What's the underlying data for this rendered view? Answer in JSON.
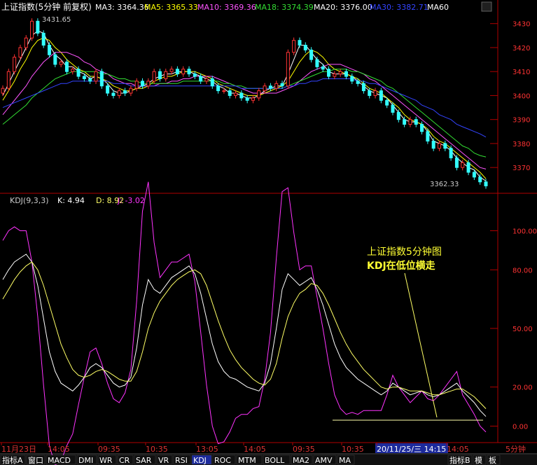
{
  "main_header": {
    "title": "上证指数(5分钟 前复权)",
    "ma": [
      {
        "label": "MA3: 3364.36",
        "color": "#ffffff"
      },
      {
        "label": "MA5: 3365.33",
        "color": "#ffff00"
      },
      {
        "label": "MA10: 3369.36",
        "color": "#ff55ff"
      },
      {
        "label": "MA18: 3374.39",
        "color": "#33dd33"
      },
      {
        "label": "MA20: 3376.00",
        "color": "#ffffff"
      },
      {
        "label": "MA30: 3382.71",
        "color": "#3344ff"
      },
      {
        "label": "MA60",
        "color": "#ffffff"
      }
    ]
  },
  "kdj_header": {
    "label": "KDJ(9,3,3)",
    "k": "K: 4.94",
    "d": "D: 8.92",
    "j": "J: -3.02"
  },
  "annotations": {
    "high": "3431.65",
    "low": "3362.33",
    "note_line1": "上证指数5分钟图",
    "note_line2": "KDJ在低位横走"
  },
  "x_axis": {
    "ticks": [
      "11月23日",
      "14:05",
      "09:35",
      "10:35",
      "13:05",
      "14:05",
      "09:35",
      "10:35",
      "20/11/25/三 14:15",
      "14:05",
      "5分钟"
    ]
  },
  "bottom_tabs": {
    "left": [
      "指标A",
      "窗口",
      "MACD",
      "DMI",
      "WR",
      "CR",
      "SAR",
      "VR",
      "RSI",
      "KDJ",
      "ROC",
      "MTM",
      "BOLL",
      "MA2",
      "AMV",
      "MA"
    ],
    "right": [
      "指标B",
      "模",
      "板"
    ],
    "active": "KDJ"
  },
  "colors": {
    "axis": "#b00000",
    "grid": "#5a0000",
    "up": "#ff3333",
    "down": "#33ffff",
    "k_line": "#ffffff",
    "d_line": "#ffff66",
    "j_line": "#ff33ff",
    "note": "#ffff33"
  },
  "chart_data": [
    {
      "type": "candlestick",
      "title": "上证指数(5分钟 前复权)",
      "ylim": [
        3361,
        3434
      ],
      "yticks": [
        3430,
        3420,
        3410,
        3400,
        3390,
        3380,
        3370
      ],
      "close": [
        3403,
        3410,
        3416,
        3420,
        3424,
        3431,
        3426,
        3421,
        3417,
        3413,
        3414,
        3410,
        3411,
        3408,
        3407,
        3406,
        3410,
        3404,
        3401,
        3400,
        3402,
        3401,
        3403,
        3406,
        3404,
        3406,
        3410,
        3407,
        3410,
        3411,
        3409,
        3411,
        3409,
        3408,
        3406,
        3407,
        3404,
        3402,
        3402,
        3400,
        3401,
        3399,
        3398,
        3399,
        3402,
        3404,
        3403,
        3405,
        3404,
        3418,
        3423,
        3421,
        3419,
        3415,
        3412,
        3411,
        3408,
        3409,
        3410,
        3408,
        3406,
        3405,
        3402,
        3400,
        3402,
        3398,
        3396,
        3393,
        3390,
        3388,
        3390,
        3388,
        3385,
        3381,
        3378,
        3380,
        3378,
        3374,
        3370,
        3372,
        3368,
        3366,
        3364,
        3362.33
      ],
      "ma_series": [
        {
          "name": "MA3",
          "color": "#ffffff",
          "values": [
            3400,
            3405,
            3410,
            3415,
            3420,
            3425,
            3427,
            3426,
            3421,
            3417,
            3415,
            3412,
            3412,
            3410,
            3409,
            3407,
            3408,
            3407,
            3405,
            3402,
            3401,
            3401,
            3402,
            3403,
            3404,
            3405,
            3407,
            3408,
            3409,
            3409,
            3410,
            3410,
            3410,
            3409,
            3408,
            3407,
            3406,
            3404,
            3403,
            3401,
            3401,
            3400,
            3399,
            3399,
            3400,
            3402,
            3403,
            3404,
            3404,
            3409,
            3415,
            3421,
            3421,
            3418,
            3415,
            3413,
            3410,
            3409,
            3409,
            3409,
            3408,
            3406,
            3404,
            3402,
            3401,
            3400,
            3399,
            3396,
            3393,
            3390,
            3389,
            3389,
            3388,
            3385,
            3381,
            3380,
            3379,
            3377,
            3374,
            3372,
            3370,
            3369,
            3366,
            3364.36
          ]
        },
        {
          "name": "MA5",
          "color": "#ffff00",
          "values": [
            3398,
            3402,
            3406,
            3411,
            3415,
            3420,
            3423,
            3424,
            3423,
            3420,
            3418,
            3415,
            3413,
            3411,
            3410,
            3408,
            3408,
            3407,
            3406,
            3404,
            3403,
            3402,
            3402,
            3403,
            3403,
            3404,
            3406,
            3407,
            3408,
            3408,
            3409,
            3410,
            3410,
            3410,
            3409,
            3408,
            3407,
            3405,
            3404,
            3403,
            3402,
            3401,
            3400,
            3400,
            3400,
            3401,
            3402,
            3403,
            3404,
            3406,
            3410,
            3414,
            3417,
            3419,
            3418,
            3416,
            3413,
            3411,
            3410,
            3409,
            3408,
            3407,
            3405,
            3403,
            3402,
            3401,
            3399,
            3397,
            3395,
            3392,
            3390,
            3389,
            3388,
            3386,
            3383,
            3381,
            3380,
            3378,
            3376,
            3374,
            3372,
            3370,
            3368,
            3365.33
          ]
        },
        {
          "name": "MA10",
          "color": "#ff55ff",
          "values": [
            3392,
            3395,
            3398,
            3401,
            3404,
            3408,
            3411,
            3414,
            3416,
            3418,
            3418,
            3418,
            3417,
            3416,
            3414,
            3413,
            3411,
            3410,
            3409,
            3407,
            3406,
            3405,
            3405,
            3404,
            3404,
            3404,
            3404,
            3405,
            3405,
            3406,
            3406,
            3407,
            3407,
            3408,
            3408,
            3408,
            3408,
            3407,
            3406,
            3405,
            3404,
            3403,
            3402,
            3401,
            3401,
            3401,
            3401,
            3401,
            3402,
            3403,
            3404,
            3406,
            3408,
            3410,
            3411,
            3412,
            3413,
            3413,
            3413,
            3412,
            3411,
            3410,
            3409,
            3407,
            3406,
            3404,
            3402,
            3400,
            3398,
            3396,
            3394,
            3392,
            3390,
            3388,
            3386,
            3384,
            3382,
            3380,
            3378,
            3376,
            3374,
            3372,
            3370,
            3369.36
          ]
        },
        {
          "name": "MA18",
          "color": "#33dd33",
          "values": [
            3388,
            3390,
            3392,
            3394,
            3396,
            3399,
            3401,
            3403,
            3405,
            3407,
            3408,
            3409,
            3410,
            3410,
            3410,
            3410,
            3410,
            3409,
            3409,
            3408,
            3407,
            3407,
            3406,
            3406,
            3405,
            3405,
            3405,
            3405,
            3405,
            3405,
            3405,
            3406,
            3406,
            3406,
            3406,
            3406,
            3406,
            3406,
            3405,
            3405,
            3404,
            3404,
            3403,
            3403,
            3403,
            3403,
            3403,
            3403,
            3403,
            3404,
            3405,
            3406,
            3407,
            3408,
            3409,
            3410,
            3410,
            3411,
            3411,
            3411,
            3410,
            3410,
            3409,
            3408,
            3407,
            3406,
            3404,
            3403,
            3401,
            3399,
            3397,
            3395,
            3393,
            3391,
            3389,
            3387,
            3385,
            3383,
            3381,
            3379,
            3378,
            3376,
            3375,
            3374.39
          ]
        },
        {
          "name": "MA30",
          "color": "#3344ff",
          "values": [
            3395,
            3396,
            3397,
            3398,
            3399,
            3400,
            3401,
            3402,
            3403,
            3404,
            3405,
            3405,
            3406,
            3406,
            3406,
            3406,
            3406,
            3406,
            3406,
            3405,
            3405,
            3405,
            3404,
            3404,
            3404,
            3404,
            3404,
            3404,
            3404,
            3404,
            3404,
            3404,
            3404,
            3404,
            3404,
            3404,
            3404,
            3404,
            3404,
            3404,
            3404,
            3403,
            3403,
            3403,
            3403,
            3403,
            3403,
            3403,
            3403,
            3404,
            3404,
            3405,
            3405,
            3406,
            3406,
            3407,
            3407,
            3407,
            3407,
            3407,
            3407,
            3406,
            3406,
            3405,
            3405,
            3404,
            3403,
            3402,
            3401,
            3400,
            3399,
            3398,
            3396,
            3395,
            3394,
            3392,
            3391,
            3390,
            3388,
            3387,
            3386,
            3385,
            3384,
            3382.71
          ]
        }
      ]
    },
    {
      "type": "line",
      "title": "KDJ(9,3,3)",
      "ylim": [
        -7,
        112
      ],
      "yticks": [
        100,
        80,
        50,
        20,
        0
      ],
      "series": [
        {
          "name": "K",
          "color": "#ffffff",
          "values": [
            75,
            80,
            84,
            86,
            88,
            84,
            72,
            55,
            38,
            28,
            22,
            20,
            18,
            21,
            25,
            30,
            32,
            30,
            26,
            22,
            20,
            21,
            25,
            40,
            62,
            75,
            70,
            68,
            72,
            76,
            78,
            80,
            82,
            78,
            68,
            55,
            42,
            33,
            28,
            25,
            24,
            22,
            20,
            19,
            18,
            22,
            32,
            50,
            70,
            78,
            75,
            72,
            74,
            76,
            70,
            62,
            52,
            42,
            35,
            30,
            27,
            24,
            22,
            20,
            18,
            16,
            18,
            22,
            20,
            18,
            16,
            17,
            18,
            16,
            15,
            16,
            18,
            20,
            22,
            18,
            15,
            12,
            8,
            4.94
          ]
        },
        {
          "name": "D",
          "color": "#ffff66",
          "values": [
            65,
            70,
            75,
            79,
            82,
            84,
            80,
            72,
            62,
            52,
            42,
            35,
            29,
            26,
            25,
            26,
            28,
            29,
            28,
            26,
            24,
            23,
            23,
            28,
            38,
            50,
            58,
            64,
            68,
            72,
            75,
            77,
            79,
            80,
            78,
            72,
            63,
            54,
            46,
            39,
            34,
            30,
            27,
            24,
            22,
            21,
            24,
            32,
            45,
            56,
            63,
            68,
            70,
            73,
            72,
            68,
            62,
            55,
            48,
            42,
            37,
            33,
            29,
            26,
            23,
            20,
            19,
            20,
            20,
            19,
            18,
            18,
            18,
            17,
            16,
            16,
            17,
            18,
            19,
            19,
            17,
            15,
            12,
            8.92
          ]
        },
        {
          "name": "J",
          "color": "#ff33ff",
          "values": [
            95,
            100,
            102,
            100,
            100,
            84,
            56,
            21,
            -10,
            -20,
            -18,
            -10,
            -4,
            11,
            25,
            38,
            40,
            32,
            22,
            14,
            12,
            17,
            29,
            64,
            110,
            125,
            94,
            76,
            80,
            84,
            84,
            86,
            88,
            74,
            48,
            21,
            0,
            -9,
            -8,
            -3,
            4,
            6,
            6,
            9,
            10,
            24,
            48,
            86,
            120,
            122,
            99,
            80,
            82,
            82,
            66,
            50,
            32,
            16,
            9,
            6,
            7,
            6,
            8,
            8,
            8,
            8,
            16,
            26,
            20,
            16,
            12,
            15,
            18,
            14,
            13,
            16,
            20,
            24,
            28,
            16,
            11,
            6,
            0,
            -3.02
          ]
        }
      ],
      "note": "上证指数5分钟图 KDJ在低位横走"
    }
  ]
}
